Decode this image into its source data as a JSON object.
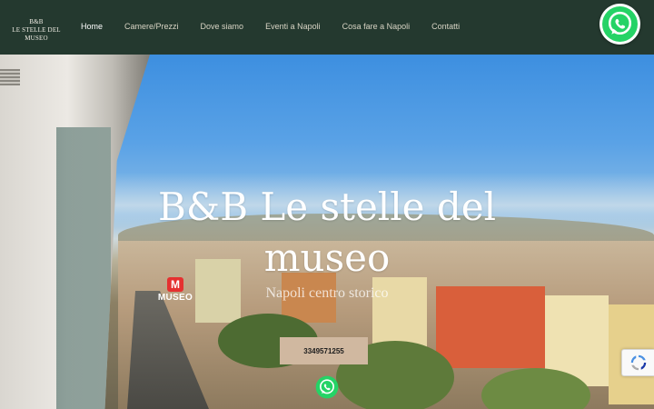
{
  "logo": {
    "line1": "B&B",
    "line2": "LE STELLE DEL MUSEO"
  },
  "nav": {
    "items": [
      {
        "label": "Home",
        "active": true
      },
      {
        "label": "Camere/Prezzi",
        "active": false
      },
      {
        "label": "Dove siamo",
        "active": false
      },
      {
        "label": "Eventi a Napoli",
        "active": false
      },
      {
        "label": "Cosa fare a Napoli",
        "active": false
      },
      {
        "label": "Contatti",
        "active": false
      }
    ]
  },
  "hero": {
    "title_line1": "B&B Le stelle del",
    "title_line2": "museo",
    "subtitle": "Napoli centro storico",
    "phone_button": "3349571255",
    "metro_sign": {
      "letter": "M",
      "text": "MUSEO"
    }
  },
  "icons": {
    "whatsapp_top": "whatsapp-icon",
    "whatsapp_hero": "whatsapp-icon",
    "recaptcha": "recaptcha-icon"
  },
  "colors": {
    "navbar": "#24392f",
    "button": "#d0b8a0",
    "whatsapp": "#25d366",
    "metro": "#e53030"
  }
}
